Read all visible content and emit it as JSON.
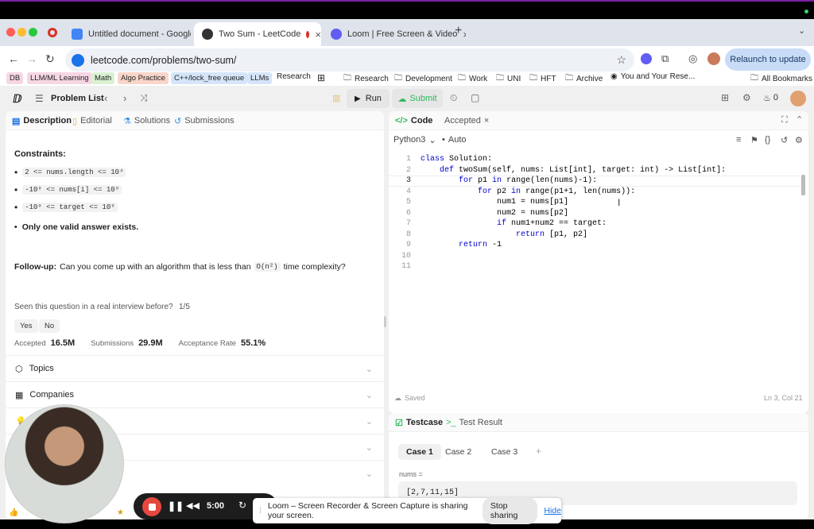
{
  "tabs": [
    {
      "title": "Untitled document - Google",
      "icon": "google-docs-icon",
      "active": false
    },
    {
      "title": "Two Sum - LeetCode",
      "icon": "leetcode-icon",
      "active": true
    },
    {
      "title": "Loom | Free Screen & Video",
      "icon": "loom-icon",
      "active": false
    }
  ],
  "address": {
    "url": "leetcode.com/problems/two-sum/",
    "relaunch": "Relaunch to update"
  },
  "bookmarks": [
    "DB",
    "LLM/ML Learning",
    "Math",
    "Algo Practice",
    "C++/lock_free queue",
    "LLMs",
    "Research",
    "Research",
    "Development",
    "Work",
    "UNI",
    "HFT",
    "Archive",
    "You and Your Rese...",
    "All Bookmarks"
  ],
  "lc": {
    "problem_list": "Problem List",
    "run": "Run",
    "submit": "Submit",
    "streak": "0"
  },
  "left_tabs": [
    "Description",
    "Editorial",
    "Solutions",
    "Submissions"
  ],
  "desc": {
    "constraints": "Constraints:",
    "c1": "2 <= nums.length <= 10⁴",
    "c2": "-10⁹ <= nums[i] <= 10⁹",
    "c3": "-10⁹ <= target <= 10⁹",
    "c4": "Only one valid answer exists.",
    "followup_label": "Follow-up:",
    "followup": "Can you come up with an algorithm that is less than",
    "complexity": "O(n²)",
    "followup_end": "time complexity?",
    "seen": "Seen this question in a real interview before?",
    "seen_count": "1/5",
    "yes": "Yes",
    "no": "No",
    "accepted_label": "Accepted",
    "accepted": "16.5M",
    "subs_label": "Submissions",
    "subs": "29.9M",
    "rate_label": "Acceptance Rate",
    "rate": "55.1%",
    "topics": "Topics",
    "companies": "Companies"
  },
  "editor": {
    "tab_code": "Code",
    "tab_accepted": "Accepted",
    "lang": "Python3",
    "auto": "Auto",
    "saved": "Saved",
    "pos": "Ln 3, Col 21",
    "lines": [
      "1",
      "2",
      "3",
      "4",
      "5",
      "6",
      "7",
      "8",
      "9",
      "10",
      "11"
    ],
    "code": [
      "class Solution:",
      "    def twoSum(self, nums: List[int], target: int) -> List[int]:",
      "        for p1 in range(len(nums)-1):",
      "            for p2 in range(p1+1, len(nums)):",
      "                num1 = nums[p1]",
      "                num2 = nums[p2]",
      "                if num1+num2 == target:",
      "                    return [p1, p2]",
      "        return -1",
      "",
      ""
    ]
  },
  "testcase": {
    "tab": "Testcase",
    "result": "Test Result",
    "cases": [
      "Case 1",
      "Case 2",
      "Case 3"
    ],
    "nums_label": "nums =",
    "nums_value": "[2,7,11,15]"
  },
  "recorder": {
    "time": "5:00"
  },
  "loom": {
    "msg": "Loom – Screen Recorder & Screen Capture is sharing your screen.",
    "stop": "Stop sharing",
    "hide": "Hide"
  },
  "colors": {
    "accent_green": "#2cbb5d",
    "record_red": "#e5483e",
    "brand_blue": "#1a73e8"
  }
}
